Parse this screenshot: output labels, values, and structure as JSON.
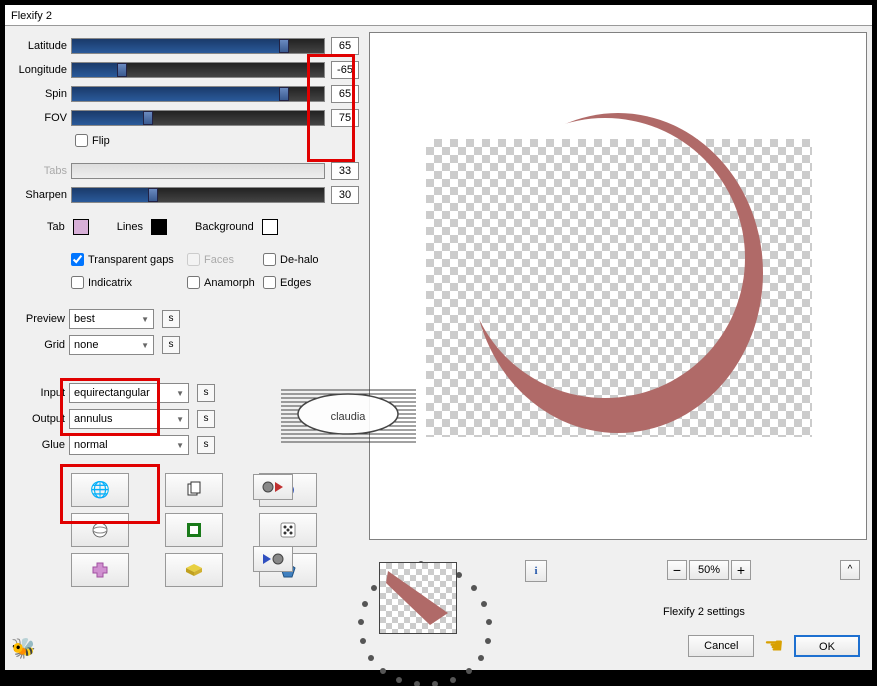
{
  "window": {
    "title": "Flexify 2"
  },
  "sliders": {
    "latitude": {
      "label": "Latitude",
      "value": "65",
      "fill": 82
    },
    "longitude": {
      "label": "Longitude",
      "value": "-65",
      "fill": 18
    },
    "spin": {
      "label": "Spin",
      "value": "65",
      "fill": 82
    },
    "fov": {
      "label": "FOV",
      "value": "75",
      "fill": 28
    },
    "tabs": {
      "label": "Tabs",
      "value": "33",
      "fill": 0
    },
    "sharpen": {
      "label": "Sharpen",
      "value": "30",
      "fill": 30
    }
  },
  "flip": {
    "label": "Flip",
    "checked": false
  },
  "colors": {
    "tab": {
      "label": "Tab",
      "hex": "#d8b0d8"
    },
    "lines": {
      "label": "Lines",
      "hex": "#000000"
    },
    "background": {
      "label": "Background",
      "hex": "#ffffff"
    }
  },
  "checkboxes": {
    "transparent_gaps": {
      "label": "Transparent gaps",
      "checked": true
    },
    "faces": {
      "label": "Faces",
      "checked": false
    },
    "dehalo": {
      "label": "De-halo",
      "checked": false
    },
    "indicatrix": {
      "label": "Indicatrix",
      "checked": false
    },
    "anamorph": {
      "label": "Anamorph",
      "checked": false
    },
    "edges": {
      "label": "Edges",
      "checked": false
    }
  },
  "dropdowns": {
    "preview": {
      "label": "Preview",
      "value": "best"
    },
    "grid": {
      "label": "Grid",
      "value": "none"
    },
    "input": {
      "label": "Input",
      "value": "equirectangular"
    },
    "output": {
      "label": "Output",
      "value": "annulus"
    },
    "glue": {
      "label": "Glue",
      "value": "normal"
    }
  },
  "zoom": {
    "value": "50%"
  },
  "settings_label": "Flexify 2 settings",
  "buttons": {
    "cancel": "Cancel",
    "ok": "OK"
  },
  "s_button": "s",
  "watermark_text": "claudia"
}
